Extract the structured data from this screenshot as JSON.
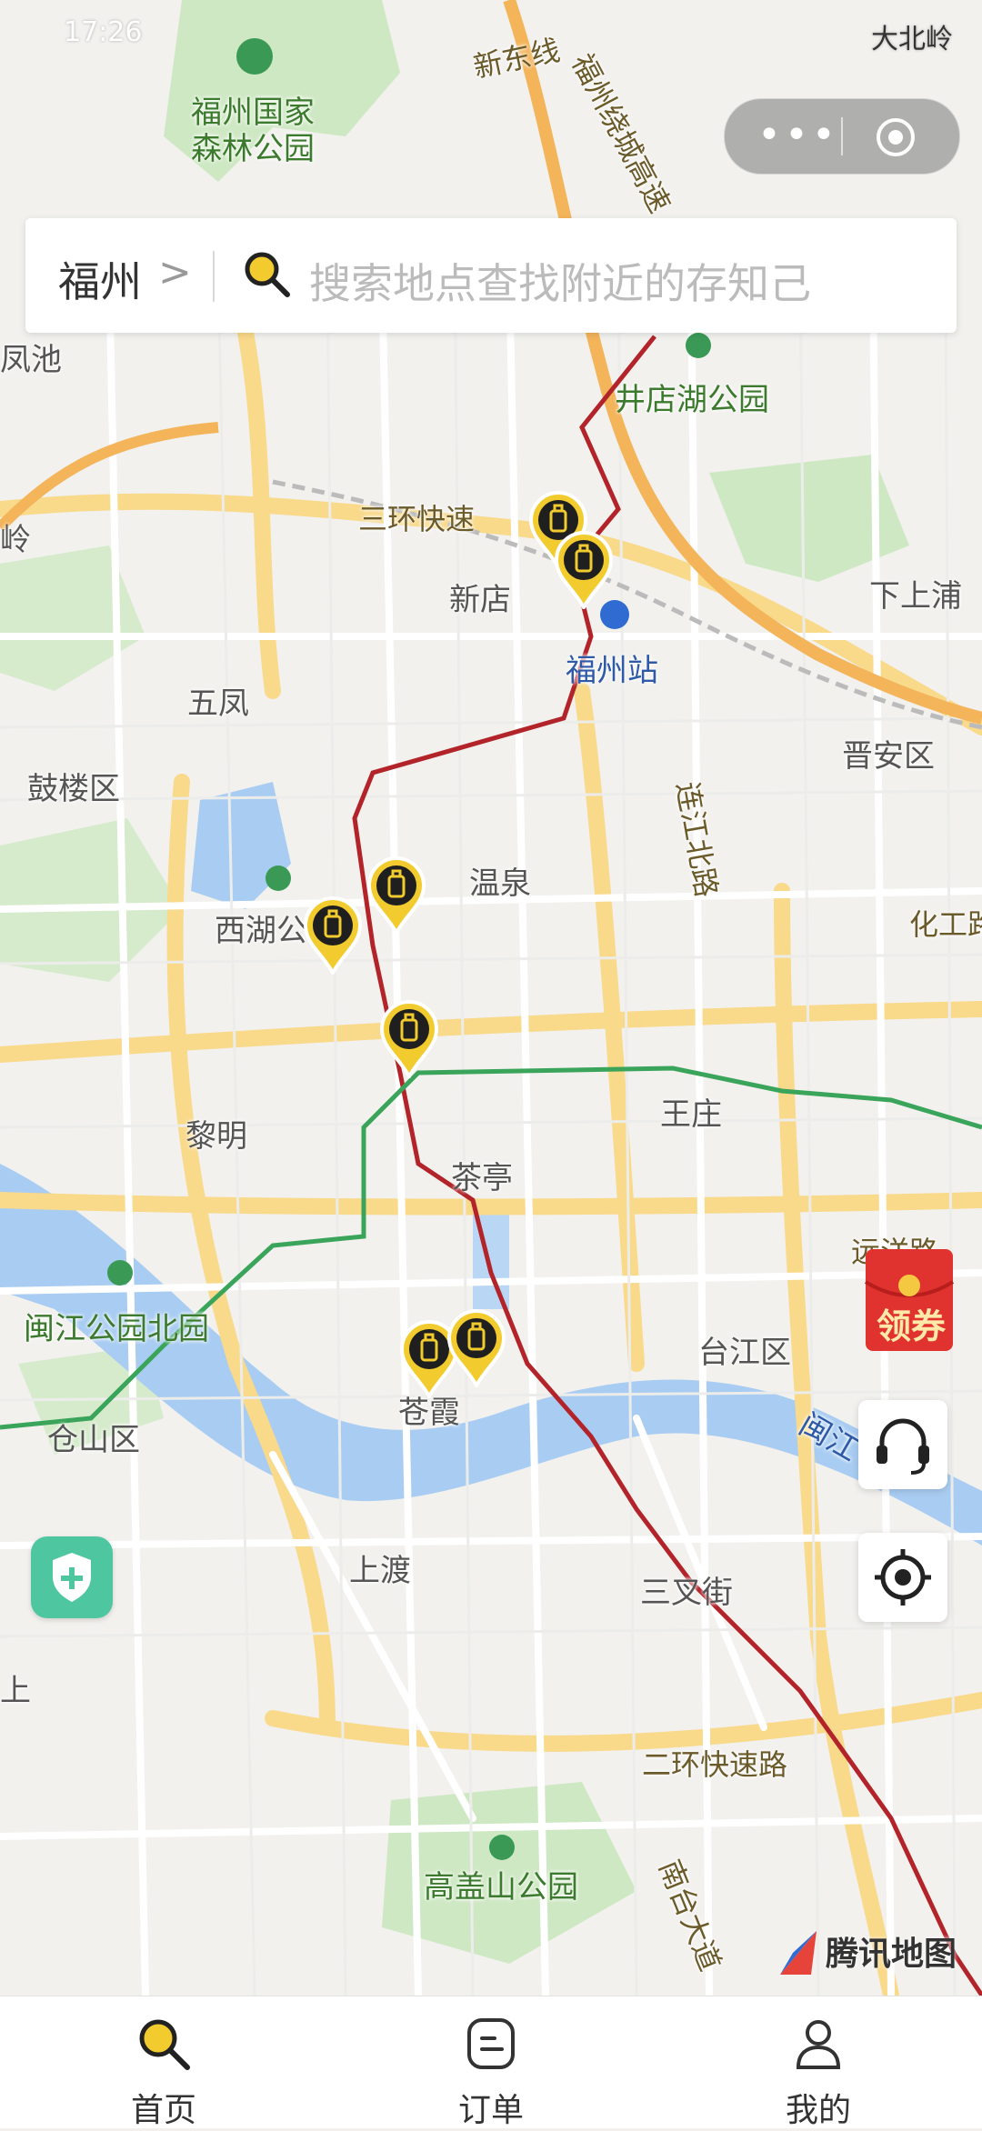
{
  "status_bar": {
    "time": "17:26",
    "right_text": "大北岭"
  },
  "capsule": {
    "more_icon": "more-dots-icon",
    "close_icon": "target-circle-icon"
  },
  "search": {
    "city": "福州",
    "chevron": ">",
    "placeholder": "搜索地点查找附近的存知己"
  },
  "map": {
    "labels": [
      {
        "text": "福州国家",
        "class": "green"
      },
      {
        "text": "森林公园",
        "class": "green"
      },
      {
        "text": "新东线",
        "class": "road"
      },
      {
        "text": "福州绕城高速",
        "class": "road"
      },
      {
        "text": "凤池",
        "class": ""
      },
      {
        "text": "井店湖公园",
        "class": "green"
      },
      {
        "text": "三环快速",
        "class": "road"
      },
      {
        "text": "岭",
        "class": ""
      },
      {
        "text": "新店",
        "class": ""
      },
      {
        "text": "下上浦",
        "class": ""
      },
      {
        "text": "福州站",
        "class": "blue"
      },
      {
        "text": "五凤",
        "class": ""
      },
      {
        "text": "晋安区",
        "class": ""
      },
      {
        "text": "鼓楼区",
        "class": ""
      },
      {
        "text": "连江北路",
        "class": "road"
      },
      {
        "text": "温泉",
        "class": ""
      },
      {
        "text": "西湖公",
        "class": ""
      },
      {
        "text": "化工路",
        "class": "road"
      },
      {
        "text": "王庄",
        "class": ""
      },
      {
        "text": "黎明",
        "class": ""
      },
      {
        "text": "茶亭",
        "class": ""
      },
      {
        "text": "远洋路",
        "class": "road"
      },
      {
        "text": "闽江公园北园",
        "class": "green"
      },
      {
        "text": "台江区",
        "class": ""
      },
      {
        "text": "仓山区",
        "class": ""
      },
      {
        "text": "苍霞",
        "class": ""
      },
      {
        "text": "闽江",
        "class": "blue"
      },
      {
        "text": "上渡",
        "class": ""
      },
      {
        "text": "三叉街",
        "class": ""
      },
      {
        "text": "上",
        "class": ""
      },
      {
        "text": "二环快速路",
        "class": "road"
      },
      {
        "text": "高盖山公园",
        "class": "green"
      },
      {
        "text": "南台大道",
        "class": "road"
      }
    ],
    "pins": [
      {
        "name": "luggage-pin"
      },
      {
        "name": "luggage-pin"
      },
      {
        "name": "luggage-pin"
      },
      {
        "name": "luggage-pin"
      },
      {
        "name": "luggage-pin"
      },
      {
        "name": "luggage-pin"
      },
      {
        "name": "luggage-pin"
      }
    ],
    "coupon_label": "领券",
    "provider": "腾讯地图",
    "colors": {
      "water": "#a9cdf2",
      "park": "#cfe8c4",
      "road_major": "#f9d98a",
      "metro_red": "#b2242a",
      "metro_green": "#3aa55a",
      "pin": "#f2cc2e"
    }
  },
  "tabs": [
    {
      "label": "首页",
      "icon": "home-search-icon",
      "active": true
    },
    {
      "label": "订单",
      "icon": "order-icon",
      "active": false
    },
    {
      "label": "我的",
      "icon": "profile-icon",
      "active": false
    }
  ]
}
